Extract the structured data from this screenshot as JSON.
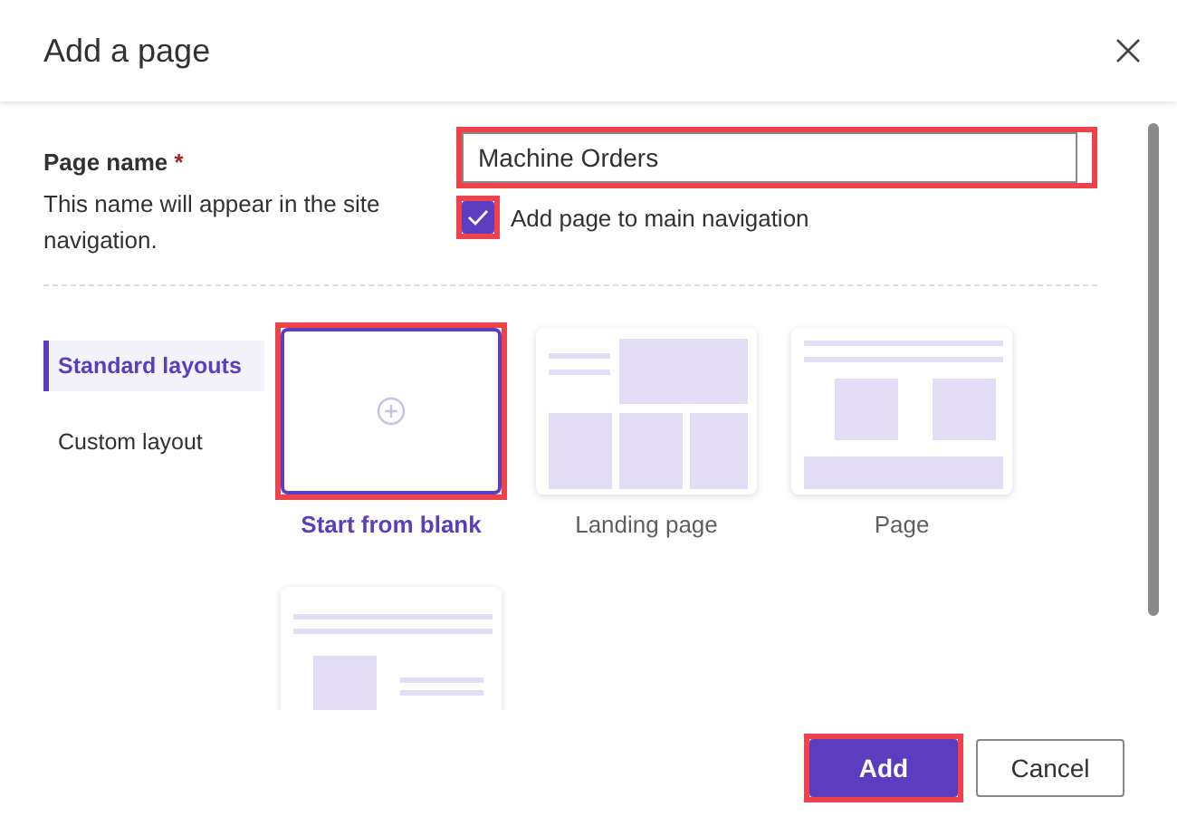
{
  "dialog": {
    "title": "Add a page"
  },
  "page_name": {
    "label": "Page name",
    "required_mark": "*",
    "description": "This name will appear in the site navigation.",
    "value": "Machine Orders",
    "highlighted": true
  },
  "navigation_option": {
    "label": "Add page to main navigation",
    "checked": true,
    "highlighted": true
  },
  "layout_nav": [
    {
      "label": "Standard layouts",
      "selected": true
    },
    {
      "label": "Custom layout",
      "selected": false
    }
  ],
  "templates": [
    {
      "kind": "blank",
      "label": "Start from blank",
      "selected": true,
      "highlighted": true
    },
    {
      "kind": "landing",
      "label": "Landing page",
      "selected": false,
      "highlighted": false
    },
    {
      "kind": "page",
      "label": "Page",
      "selected": false,
      "highlighted": false
    },
    {
      "kind": "article",
      "selected": false,
      "highlighted": false
    }
  ],
  "buttons": [
    {
      "label": "Add",
      "kind": "primary",
      "highlighted": true
    },
    {
      "label": "Cancel",
      "kind": "secondary",
      "highlighted": false
    }
  ]
}
